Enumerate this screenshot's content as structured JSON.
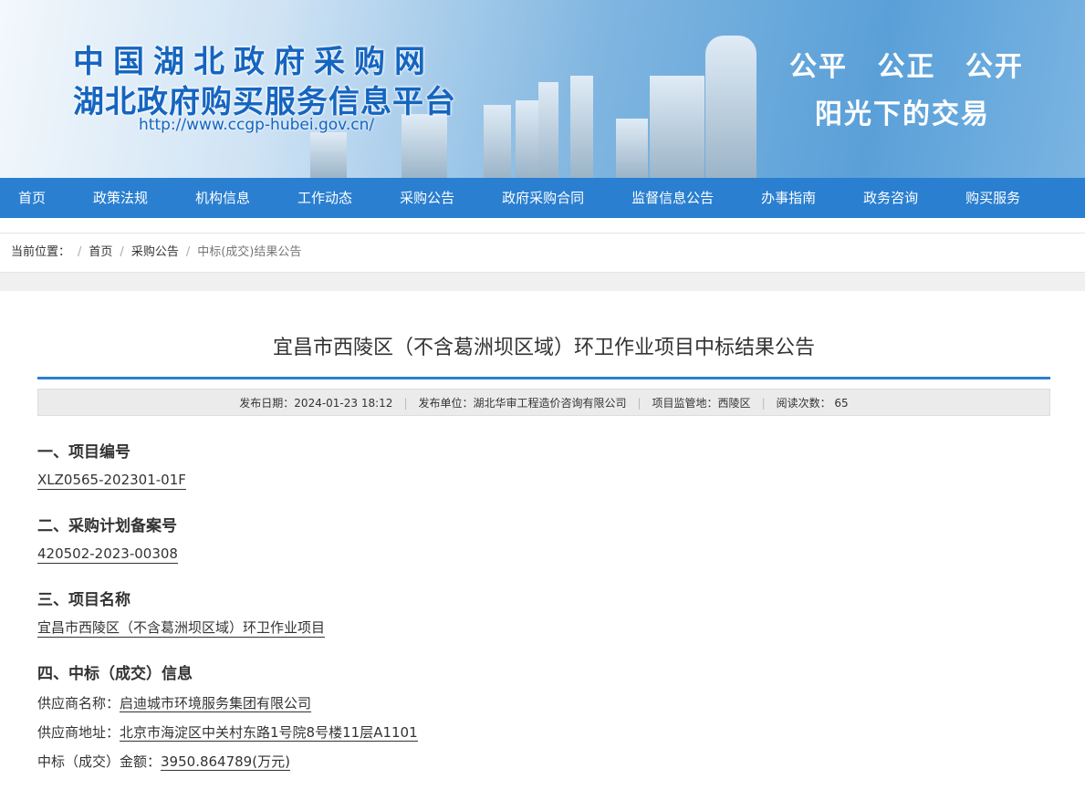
{
  "banner": {
    "title1": "中国湖北政府采购网",
    "title2": "湖北政府购买服务信息平台",
    "url": "http://www.ccgp-hubei.gov.cn/",
    "slogan1": "公平 公正 公开",
    "slogan2": "阳光下的交易"
  },
  "nav": [
    "首页",
    "政策法规",
    "机构信息",
    "工作动态",
    "采购公告",
    "政府采购合同",
    "监督信息公告",
    "办事指南",
    "政务咨询",
    "购买服务"
  ],
  "breadcrumb": {
    "label": "当前位置：",
    "items": [
      "首页",
      "采购公告",
      "中标(成交)结果公告"
    ]
  },
  "article": {
    "title": "宜昌市西陵区（不含葛洲坝区域）环卫作业项目中标结果公告",
    "meta": {
      "date": "发布日期：2024-01-23 18:12",
      "publisher": "发布单位：湖北华审工程造价咨询有限公司",
      "region": "项目监管地：西陵区",
      "reads": "阅读次数： 65"
    },
    "sections": [
      {
        "heading": "一、项目编号",
        "value": "XLZ0565-202301-01F"
      },
      {
        "heading": "二、采购计划备案号",
        "value": "420502-2023-00308"
      },
      {
        "heading": "三、项目名称",
        "value": "宜昌市西陵区（不含葛洲坝区域）环卫作业项目"
      }
    ],
    "award": {
      "heading": "四、中标（成交）信息",
      "rows": [
        {
          "label": "供应商名称：",
          "value": "启迪城市环境服务集团有限公司"
        },
        {
          "label": "供应商地址：",
          "value": "北京市海淀区中关村东路1号院8号楼11层A1101"
        },
        {
          "label": "中标（成交）金额：",
          "value": "3950.864789(万元)"
        }
      ]
    }
  }
}
